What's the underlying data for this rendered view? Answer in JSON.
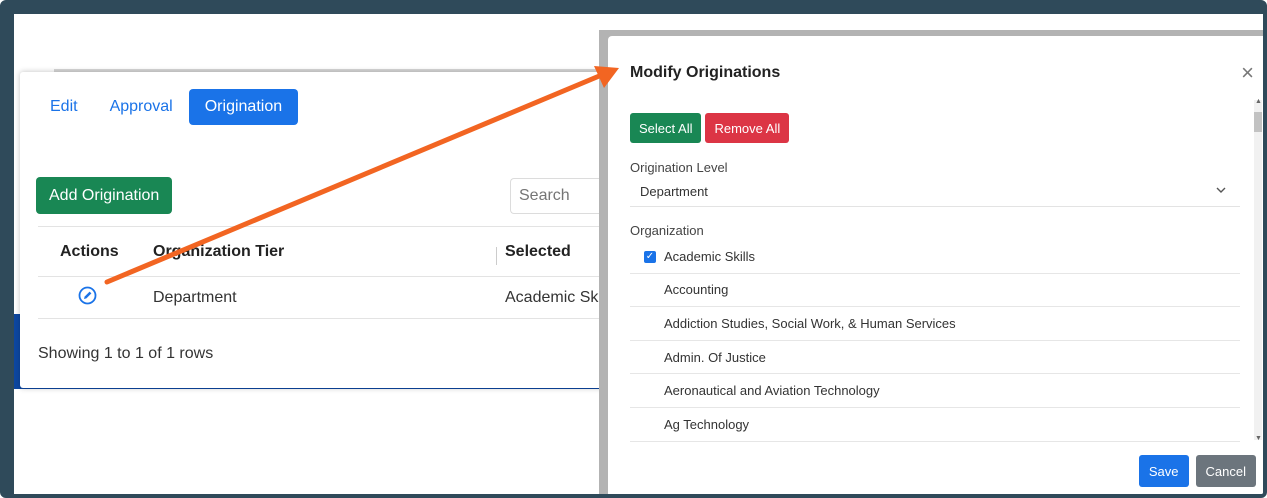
{
  "tabs": [
    "Edit",
    "Approval",
    "Origination"
  ],
  "left_panel": {
    "add_button": "Add Origination",
    "search_placeholder": "Search",
    "columns": [
      "Actions",
      "Organization Tier",
      "Selected"
    ],
    "rows": [
      {
        "tier": "Department",
        "selected": "Academic Skills"
      }
    ],
    "showing": "Showing 1 to 1 of 1 rows"
  },
  "modal": {
    "title": "Modify Originations",
    "close": "×",
    "select_all": "Select All",
    "remove_all": "Remove All",
    "origination_level_label": "Origination Level",
    "origination_level_value": "Department",
    "organization_label": "Organization",
    "organizations": [
      {
        "name": "Academic Skills",
        "checked": true
      },
      {
        "name": "Accounting",
        "checked": false
      },
      {
        "name": "Addiction Studies, Social Work, & Human Services",
        "checked": false
      },
      {
        "name": "Admin. Of Justice",
        "checked": false
      },
      {
        "name": "Aeronautical and Aviation Technology",
        "checked": false
      },
      {
        "name": "Ag Technology",
        "checked": false
      }
    ],
    "save": "Save",
    "cancel": "Cancel"
  },
  "colors": {
    "primary": "#1a73e8",
    "success": "#198754",
    "danger": "#dc3545",
    "secondary": "#6c757d",
    "annotation_arrow": "#f26522"
  },
  "icons": [
    "edit-icon",
    "close-icon",
    "chevron-down-icon",
    "checkbox-checked-icon"
  ]
}
